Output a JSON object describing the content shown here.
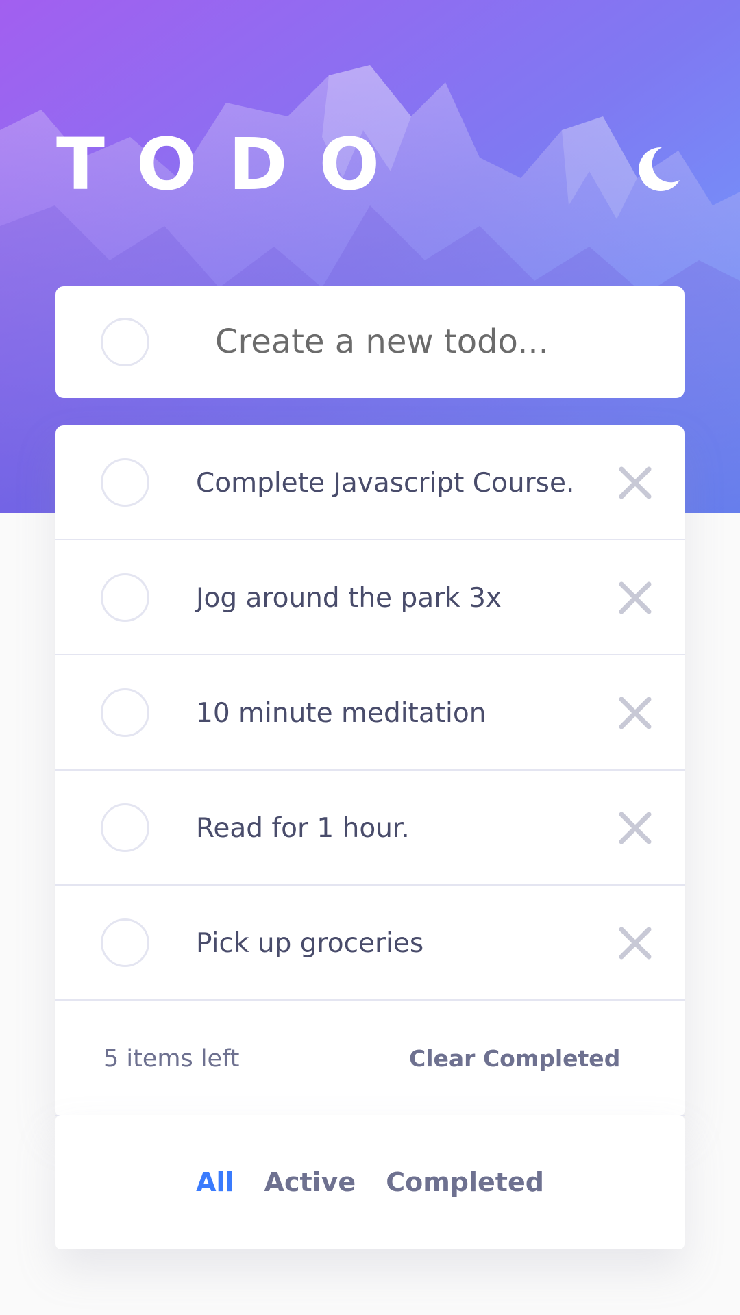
{
  "app": {
    "title": "TODO"
  },
  "theme": {
    "icon": "moon-icon",
    "accent": "#3a7bfd",
    "gradient_start": "#a25ff0",
    "gradient_end": "#6aa6ff"
  },
  "new_todo": {
    "placeholder": "Create a new todo..."
  },
  "todos": [
    {
      "text": "Complete Javascript Course."
    },
    {
      "text": "Jog around the park 3x"
    },
    {
      "text": "10 minute meditation"
    },
    {
      "text": "Read for 1 hour."
    },
    {
      "text": "Pick up groceries"
    }
  ],
  "footer": {
    "items_left": "5 items left",
    "clear_completed": "Clear Completed"
  },
  "filters": {
    "all": "All",
    "active": "Active",
    "completed": "Completed",
    "selected": "All"
  }
}
